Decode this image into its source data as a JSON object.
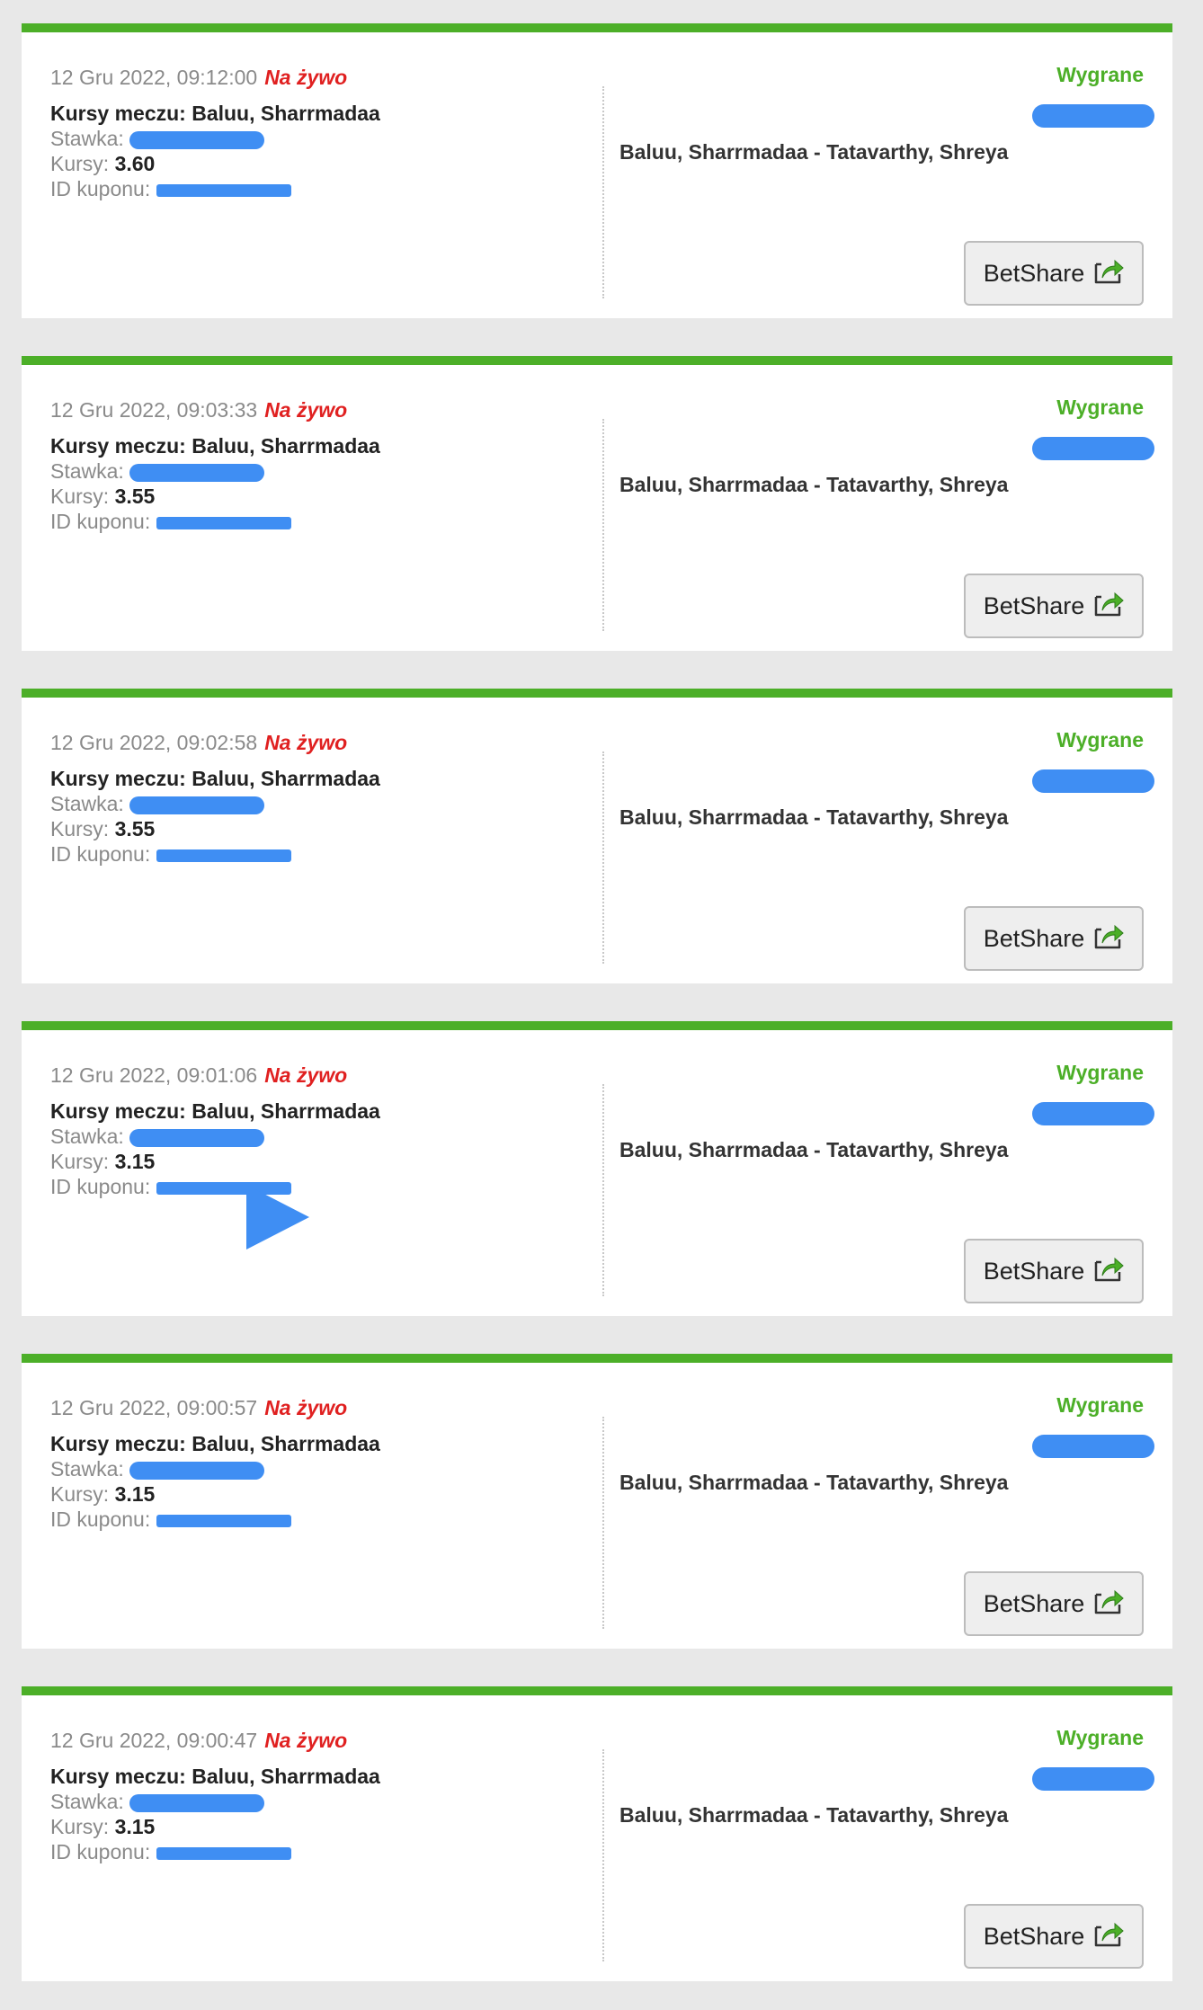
{
  "accent_color": "#4caf28",
  "live_color": "#e02020",
  "redaction_color": "#3f8ef3",
  "bets": [
    {
      "datetime": "12 Gru 2022, 09:12:00",
      "live": "Na żywo",
      "match": "Kursy meczu: Baluu, Sharrmadaa",
      "stake_label": "Stawka:",
      "odds_label": "Kursy:",
      "odds": "3.60",
      "coupon_label": "ID kuponu:",
      "event": "Baluu, Sharrmadaa - Tatavarthy, Shreya",
      "status": "Wygrane",
      "share": "BetShare"
    },
    {
      "datetime": "12 Gru 2022, 09:03:33",
      "live": "Na żywo",
      "match": "Kursy meczu: Baluu, Sharrmadaa",
      "stake_label": "Stawka:",
      "odds_label": "Kursy:",
      "odds": "3.55",
      "coupon_label": "ID kuponu:",
      "event": "Baluu, Sharrmadaa - Tatavarthy, Shreya",
      "status": "Wygrane",
      "share": "BetShare"
    },
    {
      "datetime": "12 Gru 2022, 09:02:58",
      "live": "Na żywo",
      "match": "Kursy meczu: Baluu, Sharrmadaa",
      "stake_label": "Stawka:",
      "odds_label": "Kursy:",
      "odds": "3.55",
      "coupon_label": "ID kuponu:",
      "event": "Baluu, Sharrmadaa - Tatavarthy, Shreya",
      "status": "Wygrane",
      "share": "BetShare"
    },
    {
      "datetime": "12 Gru 2022, 09:01:06",
      "live": "Na żywo",
      "match": "Kursy meczu: Baluu, Sharrmadaa",
      "stake_label": "Stawka:",
      "odds_label": "Kursy:",
      "odds": "3.15",
      "coupon_label": "ID kuponu:",
      "event": "Baluu, Sharrmadaa - Tatavarthy, Shreya",
      "status": "Wygrane",
      "share": "BetShare"
    },
    {
      "datetime": "12 Gru 2022, 09:00:57",
      "live": "Na żywo",
      "match": "Kursy meczu: Baluu, Sharrmadaa",
      "stake_label": "Stawka:",
      "odds_label": "Kursy:",
      "odds": "3.15",
      "coupon_label": "ID kuponu:",
      "event": "Baluu, Sharrmadaa - Tatavarthy, Shreya",
      "status": "Wygrane",
      "share": "BetShare"
    },
    {
      "datetime": "12 Gru 2022, 09:00:47",
      "live": "Na żywo",
      "match": "Kursy meczu: Baluu, Sharrmadaa",
      "stake_label": "Stawka:",
      "odds_label": "Kursy:",
      "odds": "3.15",
      "coupon_label": "ID kuponu:",
      "event": "Baluu, Sharrmadaa - Tatavarthy, Shreya",
      "status": "Wygrane",
      "share": "BetShare"
    }
  ]
}
